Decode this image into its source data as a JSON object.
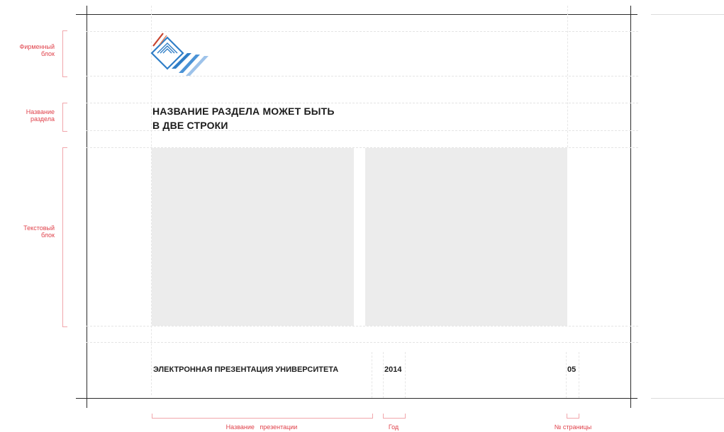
{
  "side_labels": {
    "brand_block": [
      "Фирменный",
      "блок"
    ],
    "section_name": [
      "Название",
      "раздела"
    ],
    "text_block": [
      "Текстовый",
      "блок"
    ]
  },
  "slide": {
    "section_title_line1": "НАЗВАНИЕ РАЗДЕЛА МОЖЕТ БЫТЬ",
    "section_title_line2": "В ДВЕ СТРОКИ",
    "presentation_name": "ЭЛЕКТРОННАЯ ПРЕЗЕНТАЦИЯ УНИВЕРСИТЕТА",
    "year": "2014",
    "page_number": "05"
  },
  "bottom_labels": {
    "presentation_name": "Название   презентации",
    "year": "Год",
    "page_number": "№ страницы"
  },
  "colors": {
    "annotation": "#e0424b",
    "placeholder": "#ececec",
    "logo_blue": "#2f7ec7",
    "logo_red": "#c8432d"
  }
}
